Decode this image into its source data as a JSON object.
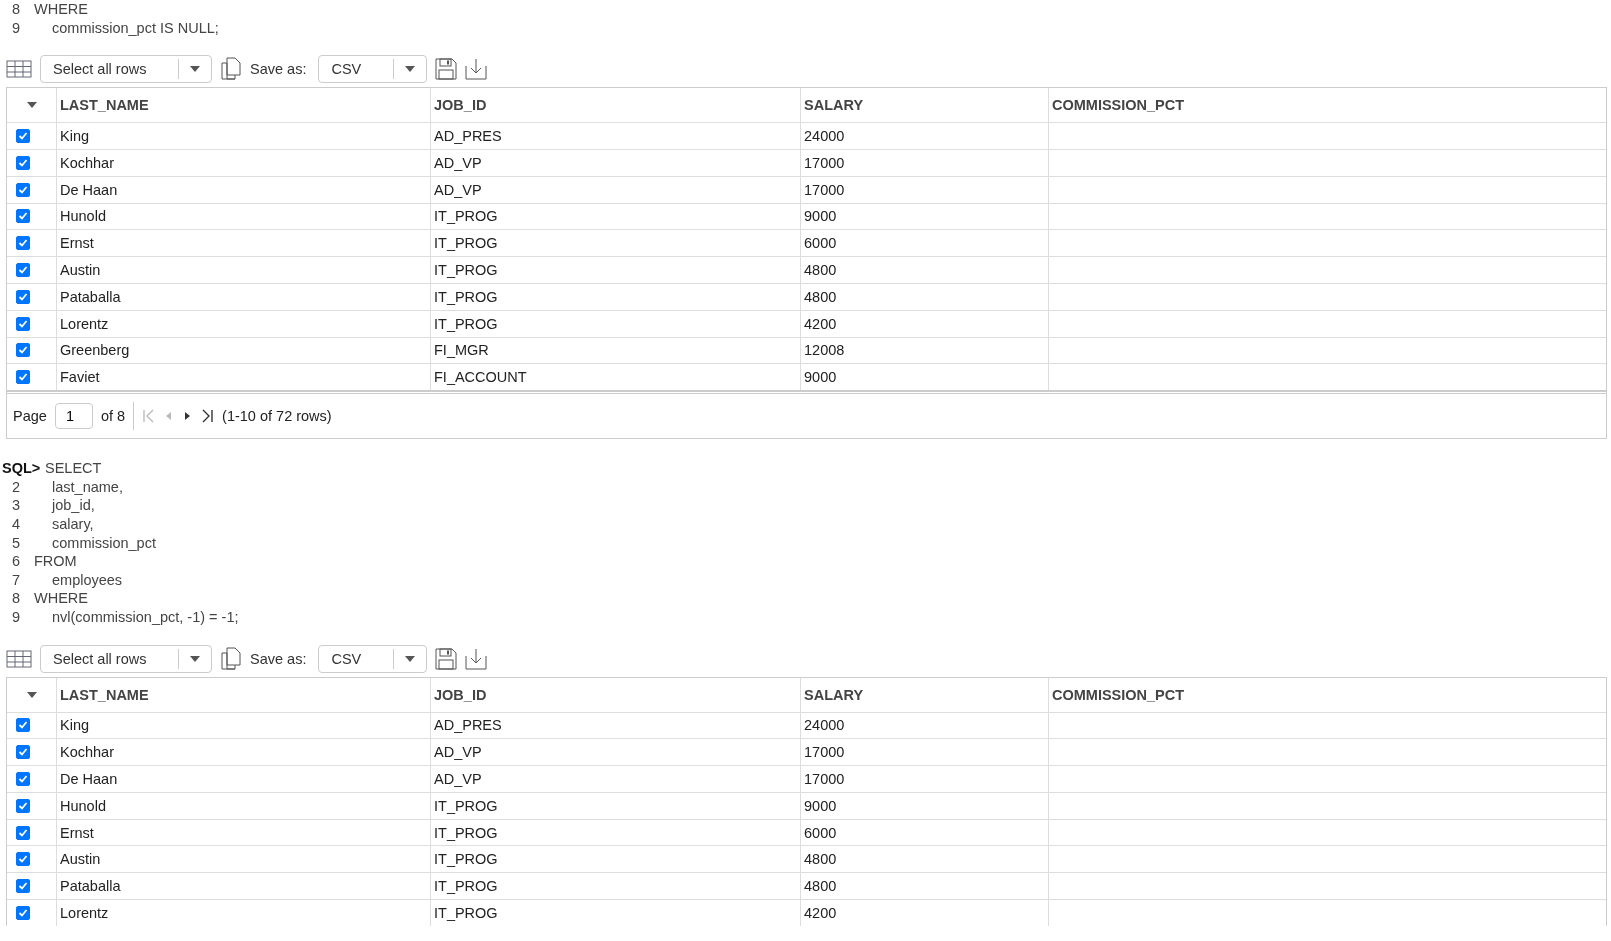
{
  "blocks": [
    {
      "kind": "sql",
      "lines": [
        {
          "kind": "line",
          "number": "8",
          "text": "WHERE",
          "indented": false
        },
        {
          "kind": "line",
          "number": "9",
          "text": "commission_pct IS NULL;",
          "indented": true
        }
      ]
    },
    {
      "kind": "results",
      "toolbar": {
        "select": "Select all rows",
        "save_label": "Save as:",
        "format": "CSV"
      },
      "columns": [
        "LAST_NAME",
        "JOB_ID",
        "SALARY",
        "COMMISSION_PCT"
      ],
      "rows": [
        {
          "checked": true,
          "cells": [
            "King",
            "AD_PRES",
            "24000"
          ]
        },
        {
          "checked": true,
          "cells": [
            "Kochhar",
            "AD_VP",
            "17000"
          ]
        },
        {
          "checked": true,
          "cells": [
            "De Haan",
            "AD_VP",
            "17000"
          ]
        },
        {
          "checked": true,
          "cells": [
            "Hunold",
            "IT_PROG",
            "9000"
          ]
        },
        {
          "checked": true,
          "cells": [
            "Ernst",
            "IT_PROG",
            "6000"
          ]
        },
        {
          "checked": true,
          "cells": [
            "Austin",
            "IT_PROG",
            "4800"
          ]
        },
        {
          "checked": true,
          "cells": [
            "Pataballa",
            "IT_PROG",
            "4800"
          ]
        },
        {
          "checked": true,
          "cells": [
            "Lorentz",
            "IT_PROG",
            "4200"
          ]
        },
        {
          "checked": true,
          "cells": [
            "Greenberg",
            "FI_MGR",
            "12008"
          ]
        },
        {
          "checked": true,
          "cells": [
            "Faviet",
            "FI_ACCOUNT",
            "9000"
          ]
        }
      ],
      "pagination": {
        "label": "Page",
        "page": "1",
        "of": "of 8",
        "summary": "(1-10 of 72 rows)"
      }
    },
    {
      "kind": "sql",
      "lines": [
        {
          "kind": "prompt",
          "number": "SQL>",
          "text": "SELECT",
          "indented": false
        },
        {
          "kind": "line",
          "number": "2",
          "text": "last_name,",
          "indented": true
        },
        {
          "kind": "line",
          "number": "3",
          "text": "job_id,",
          "indented": true
        },
        {
          "kind": "line",
          "number": "4",
          "text": "salary,",
          "indented": true
        },
        {
          "kind": "line",
          "number": "5",
          "text": "commission_pct",
          "indented": true
        },
        {
          "kind": "line",
          "number": "6",
          "text": "FROM",
          "indented": false
        },
        {
          "kind": "line",
          "number": "7",
          "text": "employees",
          "indented": true
        },
        {
          "kind": "line",
          "number": "8",
          "text": "WHERE",
          "indented": false
        },
        {
          "kind": "line",
          "number": "9",
          "text": "nvl(commission_pct, -1) = -1;",
          "indented": true
        }
      ]
    },
    {
      "kind": "results",
      "toolbar": {
        "select": "Select all rows",
        "save_label": "Save as:",
        "format": "CSV"
      },
      "columns": [
        "LAST_NAME",
        "JOB_ID",
        "SALARY",
        "COMMISSION_PCT"
      ],
      "rows": [
        {
          "checked": true,
          "cells": [
            "King",
            "AD_PRES",
            "24000"
          ]
        },
        {
          "checked": true,
          "cells": [
            "Kochhar",
            "AD_VP",
            "17000"
          ]
        },
        {
          "checked": true,
          "cells": [
            "De Haan",
            "AD_VP",
            "17000"
          ]
        },
        {
          "checked": true,
          "cells": [
            "Hunold",
            "IT_PROG",
            "9000"
          ]
        },
        {
          "checked": true,
          "cells": [
            "Ernst",
            "IT_PROG",
            "6000"
          ]
        },
        {
          "checked": true,
          "cells": [
            "Austin",
            "IT_PROG",
            "4800"
          ]
        },
        {
          "checked": true,
          "cells": [
            "Pataballa",
            "IT_PROG",
            "4800"
          ]
        },
        {
          "checked": true,
          "cells": [
            "Lorentz",
            "IT_PROG",
            "4200"
          ]
        }
      ]
    }
  ]
}
